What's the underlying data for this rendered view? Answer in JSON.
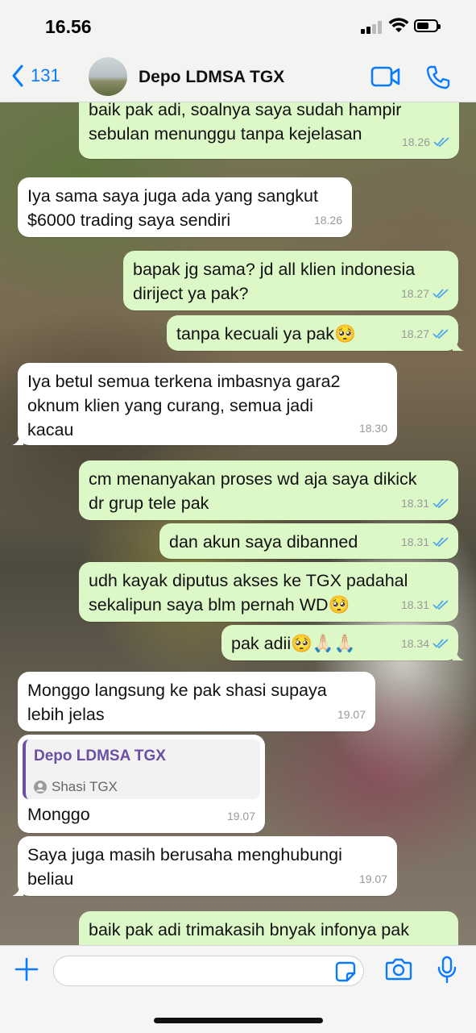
{
  "status_bar": {
    "time": "16.56"
  },
  "header": {
    "back_count": "131",
    "contact_name": "Depo LDMSA TGX"
  },
  "messages": [
    {
      "dir": "out",
      "text": "baik pak adi, soalnya saya sudah hampir\nsebulan menunggu tanpa kejelasan",
      "time": "18.26",
      "read": true
    },
    {
      "dir": "in",
      "text": "Iya sama saya juga ada yang sangkut\n$6000 trading saya sendiri",
      "time": "18.26"
    },
    {
      "dir": "out",
      "text": "bapak jg sama? jd all klien indonesia\ndiriject ya pak?",
      "time": "18.27",
      "read": true
    },
    {
      "dir": "out",
      "text": "tanpa kecuali ya pak🥺",
      "time": "18.27",
      "read": true
    },
    {
      "dir": "in",
      "text": "Iya betul semua terkena imbasnya gara2\noknum klien yang curang, semua jadi\nkacau",
      "time": "18.30"
    },
    {
      "dir": "out",
      "text": "cm menanyakan proses wd aja saya dikick\ndr grup tele pak",
      "time": "18.31",
      "read": true
    },
    {
      "dir": "out",
      "text": "dan akun saya dibanned",
      "time": "18.31",
      "read": true
    },
    {
      "dir": "out",
      "text": "udh kayak diputus akses ke TGX padahal\nsekalipun saya blm pernah WD🥺",
      "time": "18.31",
      "read": true
    },
    {
      "dir": "out",
      "text": "pak adii🥺🙏🏻🙏🏻",
      "time": "18.34",
      "read": true
    },
    {
      "dir": "in",
      "text": "Monggo langsung ke pak shasi supaya\nlebih jelas",
      "time": "19.07"
    },
    {
      "dir": "in",
      "text": "Monggo",
      "time": "19.07",
      "quote_title": "Depo LDMSA TGX",
      "quote_contact": "Shasi TGX"
    },
    {
      "dir": "in",
      "text": "Saya juga masih berusaha menghubungi\nbeliau",
      "time": "19.07"
    },
    {
      "dir": "out",
      "text": "baik pak adi trimakasih bnyak infonya pak",
      "time": "",
      "read": false
    }
  ],
  "input": {
    "placeholder": ""
  },
  "colors": {
    "outgoing_bubble": "#dcf8c6",
    "incoming_bubble": "#ffffff",
    "accent": "#0a7aff",
    "read_ticks": "#4fa6e8",
    "quote_accent": "#6a4fa5"
  },
  "icons": [
    "back-chevron-icon",
    "video-call-icon",
    "phone-icon",
    "plus-icon",
    "sticker-icon",
    "camera-icon",
    "microphone-icon",
    "read-ticks-icon",
    "contact-icon"
  ]
}
